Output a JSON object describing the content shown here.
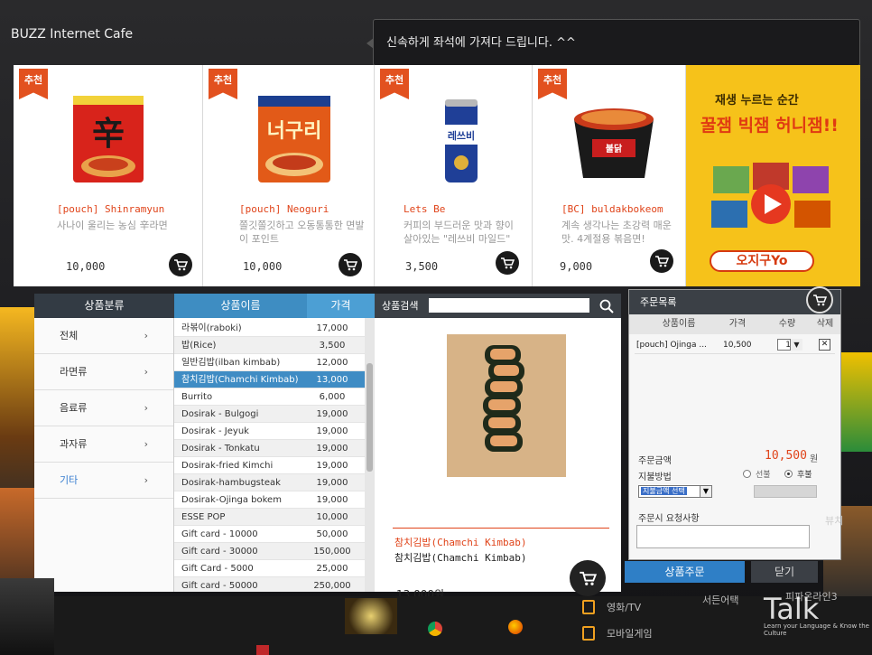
{
  "app": {
    "title": "BUZZ Internet Cafe"
  },
  "notice": {
    "text": "신속하게 좌석에 가져다 드립니다. ^^"
  },
  "promo": {
    "badge": "추천",
    "cards": [
      {
        "name": "[pouch] Shinramyun",
        "desc": "사나이 울리는 농심 辛라면",
        "price": "10,000"
      },
      {
        "name": "[pouch] Neoguri",
        "desc": "쫄깃쫄깃하고 오동통통한 면발이 포인트",
        "price": "10,000"
      },
      {
        "name": "Lets Be",
        "desc": "커피의 부드러운 맛과 향이 살아있는 \"레쓰비 마일드\"",
        "price": "3,500"
      },
      {
        "name": "[BC] buldakbokeom",
        "desc": "계속 생각나는 초강력 매운 맛. 4계절용 볶음면!",
        "price": "9,000"
      }
    ],
    "ad": {
      "line1": "재생 누르는 순간",
      "line2": "꿀잼 빅잼 허니잼!!",
      "logo": "오지구Yo"
    }
  },
  "categories": {
    "header": "상품분류",
    "items": [
      "전체",
      "라면류",
      "음료류",
      "과자류",
      "기타"
    ],
    "active_index": 4
  },
  "products": {
    "name_header": "상품이름",
    "price_header": "가격",
    "rows": [
      {
        "name": "라볶이(raboki)",
        "price": "17,000"
      },
      {
        "name": "밥(Rice)",
        "price": "3,500"
      },
      {
        "name": "일반김밥(ilban kimbab)",
        "price": "12,000"
      },
      {
        "name": "참치김밥(Chamchi Kimbab)",
        "price": "13,000"
      },
      {
        "name": "Burrito",
        "price": "6,000"
      },
      {
        "name": "Dosirak - Bulgogi",
        "price": "19,000"
      },
      {
        "name": "Dosirak - Jeyuk",
        "price": "19,000"
      },
      {
        "name": "Dosirak - Tonkatu",
        "price": "19,000"
      },
      {
        "name": "Dosirak-fried Kimchi",
        "price": "19,000"
      },
      {
        "name": "Dosirak-hambugsteak",
        "price": "19,000"
      },
      {
        "name": "Dosirak-Ojinga bokem",
        "price": "19,000"
      },
      {
        "name": "ESSE POP",
        "price": "10,000"
      },
      {
        "name": "Gift card - 10000",
        "price": "50,000"
      },
      {
        "name": "Gift card - 30000",
        "price": "150,000"
      },
      {
        "name": "Gift Card - 5000",
        "price": "25,000"
      },
      {
        "name": "Gift card - 50000",
        "price": "250,000"
      }
    ],
    "selected_index": 3
  },
  "search": {
    "label": "상품검색",
    "value": ""
  },
  "detail": {
    "name_red": "참치김밥(Chamchi Kimbab)",
    "name_black": "참치김밥(Chamchi Kimbab)",
    "price": "13,000원"
  },
  "order": {
    "header": "주문목록",
    "columns": [
      "상품이름",
      "가격",
      "수량",
      "삭제"
    ],
    "item": {
      "name": "[pouch] Ojinga ...",
      "price": "10,500",
      "qty": "1"
    },
    "total_label": "주문금액",
    "total": "10,500",
    "won": "원",
    "pay_label": "지불방법",
    "pay_options": [
      "선불",
      "후불"
    ],
    "pay_selected": "후불",
    "pay_select_value": "지불금액 선택",
    "request_label": "주문시 요청사항",
    "order_button": "상품주문",
    "close_button": "닫기"
  },
  "desktop": {
    "taskbar_items": [
      "영화/TV",
      "모바일게임"
    ],
    "side_text_1": "서든어택",
    "side_text_2": "피파온라인3",
    "side_text_3": "뷰치",
    "watermark": "Talk",
    "watermark_sub": "Learn your Language & Know the Culture"
  }
}
